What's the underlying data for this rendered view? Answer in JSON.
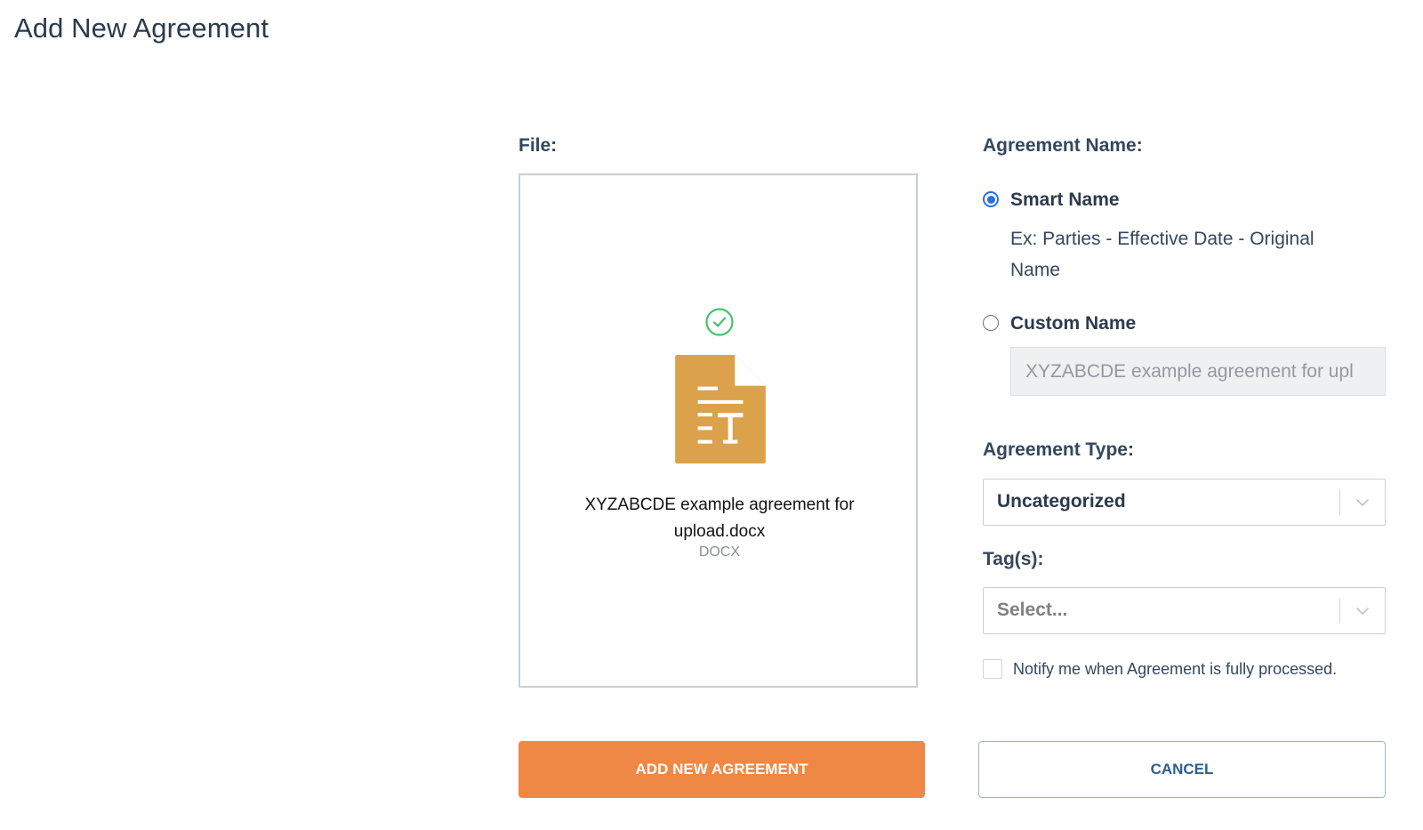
{
  "page": {
    "title": "Add New Agreement"
  },
  "file_section": {
    "label": "File:",
    "file_name": "XYZABCDE example agreement for upload.docx",
    "file_type": "DOCX",
    "upload_status_icon": "check-circle-icon",
    "file_icon": "document-text-icon",
    "file_icon_color": "#DBA14B",
    "status_color": "#47C16A"
  },
  "agreement_name": {
    "label": "Agreement Name:",
    "options": [
      {
        "label": "Smart Name",
        "selected": true,
        "example": "Ex: Parties - Effective Date - Original Name"
      },
      {
        "label": "Custom Name",
        "selected": false,
        "value": "XYZABCDE example agreement for upl"
      }
    ]
  },
  "agreement_type": {
    "label": "Agreement Type:",
    "selected": "Uncategorized"
  },
  "tags": {
    "label": "Tag(s):",
    "placeholder": "Select..."
  },
  "notify": {
    "label": "Notify me when Agreement is fully processed.",
    "checked": false
  },
  "actions": {
    "submit_label": "ADD NEW AGREEMENT",
    "cancel_label": "CANCEL",
    "submit_color": "#F08845",
    "cancel_color": "#2D5F92"
  }
}
